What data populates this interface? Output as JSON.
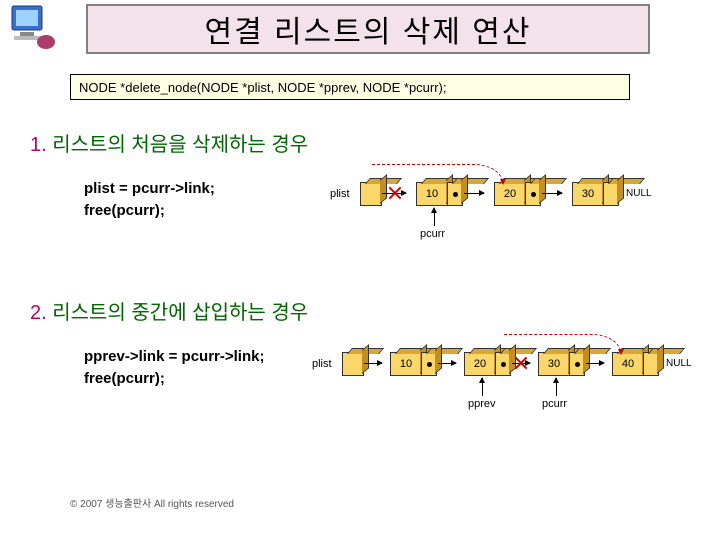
{
  "title": "연결 리스트의 삭제 연산",
  "signature": "NODE *delete_node(NODE *plist, NODE *pprev, NODE *pcurr);",
  "section1": {
    "num": "1.",
    "text": "리스트의 처음을 삭제하는 경우"
  },
  "section2": {
    "num": "2.",
    "text": "리스트의 중간에 삽입하는 경우"
  },
  "code1": {
    "l1": "plist = pcurr->link;",
    "l2": "free(pcurr);"
  },
  "code2": {
    "l1": "pprev->link = pcurr->link;",
    "l2": "free(pcurr);"
  },
  "diagram1": {
    "plist_label": "plist",
    "pcurr_label": "pcurr",
    "nodes": [
      "10",
      "20",
      "30"
    ],
    "null_label": "NULL"
  },
  "diagram2": {
    "plist_label": "plist",
    "pprev_label": "pprev",
    "pcurr_label": "pcurr",
    "nodes": [
      "10",
      "20",
      "30",
      "40"
    ],
    "null_label": "NULL"
  },
  "footer": "© 2007 생능출판사  All rights reserved"
}
